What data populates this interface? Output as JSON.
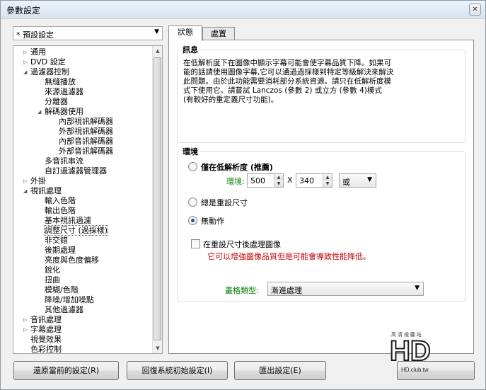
{
  "window": {
    "title": "參數設定",
    "close_glyph": "✕"
  },
  "preset": {
    "value": "* 預設設定"
  },
  "tree": [
    {
      "label": "通用",
      "toggle": "▷"
    },
    {
      "label": "DVD 設定",
      "toggle": "▷"
    },
    {
      "label": "過濾器控制",
      "toggle": "◢"
    },
    {
      "label": "無縫播放",
      "toggle": ""
    },
    {
      "label": "來源過濾器",
      "toggle": ""
    },
    {
      "label": "分離器",
      "toggle": ""
    },
    {
      "label": "解碼器使用",
      "toggle": "◢"
    },
    {
      "label": "內部視訊解碼器",
      "toggle": ""
    },
    {
      "label": "外部視訊解碼器",
      "toggle": ""
    },
    {
      "label": "內部音訊解碼器",
      "toggle": ""
    },
    {
      "label": "外部音訊解碼器",
      "toggle": ""
    },
    {
      "label": "多音訊串流",
      "toggle": ""
    },
    {
      "label": "自訂過濾器管理器",
      "toggle": ""
    },
    {
      "label": "外掛",
      "toggle": "▷"
    },
    {
      "label": "視訊處理",
      "toggle": "◢"
    },
    {
      "label": "輸入色階",
      "toggle": ""
    },
    {
      "label": "輸出色階",
      "toggle": ""
    },
    {
      "label": "基本視訊過濾",
      "toggle": ""
    },
    {
      "label": "調整尺寸 (過採樣)",
      "toggle": ""
    },
    {
      "label": "非交錯",
      "toggle": ""
    },
    {
      "label": "後期處理",
      "toggle": ""
    },
    {
      "label": "亮度與色度偏移",
      "toggle": ""
    },
    {
      "label": "銳化",
      "toggle": ""
    },
    {
      "label": "扭曲",
      "toggle": ""
    },
    {
      "label": "模糊/色階",
      "toggle": ""
    },
    {
      "label": "降噪/增加噪點",
      "toggle": ""
    },
    {
      "label": "其他過濾器",
      "toggle": ""
    },
    {
      "label": "音訊處理",
      "toggle": "▷"
    },
    {
      "label": "字幕處理",
      "toggle": "▷"
    },
    {
      "label": "視覺效果",
      "toggle": ""
    },
    {
      "label": "色彩控制",
      "toggle": ""
    }
  ],
  "tabs": {
    "status": "狀態",
    "settings": "處置"
  },
  "info": {
    "heading": "訊息",
    "lines": [
      "在低解析度下在圖像中顯示字幕可能會使字幕品質下降。如果可",
      "能的話請使用圖像字幕,它可以通過過採樣到特定等級解決來解決",
      "此問題。由於此功能需要消耗部分系統資源。請只在低解析度模",
      "式下使用它。請嘗試 Lanczos (參數 2) 或立方 (參數 4)模式",
      "(有較好的重定義尺寸功能)。"
    ]
  },
  "env": {
    "heading": "環境",
    "opt_low": "僅在低解析度 (推薦)",
    "env_label": "環境:",
    "width": "500",
    "times": "X",
    "height": "340",
    "cond": "或",
    "opt_always": "總是重設尺寸",
    "opt_none": "無動作",
    "chk_label": "在重設尺寸後處理圖像",
    "warning": "它可以增強圖像品質但是可能會導致性能降低。",
    "style_label": "畫格類型:",
    "style_value": "漸進處理"
  },
  "buttons": {
    "restore": "還原當前的設定(R)",
    "defaults": "回復系統初始設定(I)",
    "export": "匯出設定(E)"
  },
  "logo": {
    "text": "HD",
    "sub": "高 清 視 聽 站",
    "url": "HD.club.tw"
  },
  "colors": {
    "warning": "#c00000",
    "env_label": "#008000",
    "style_label": "#008000"
  }
}
